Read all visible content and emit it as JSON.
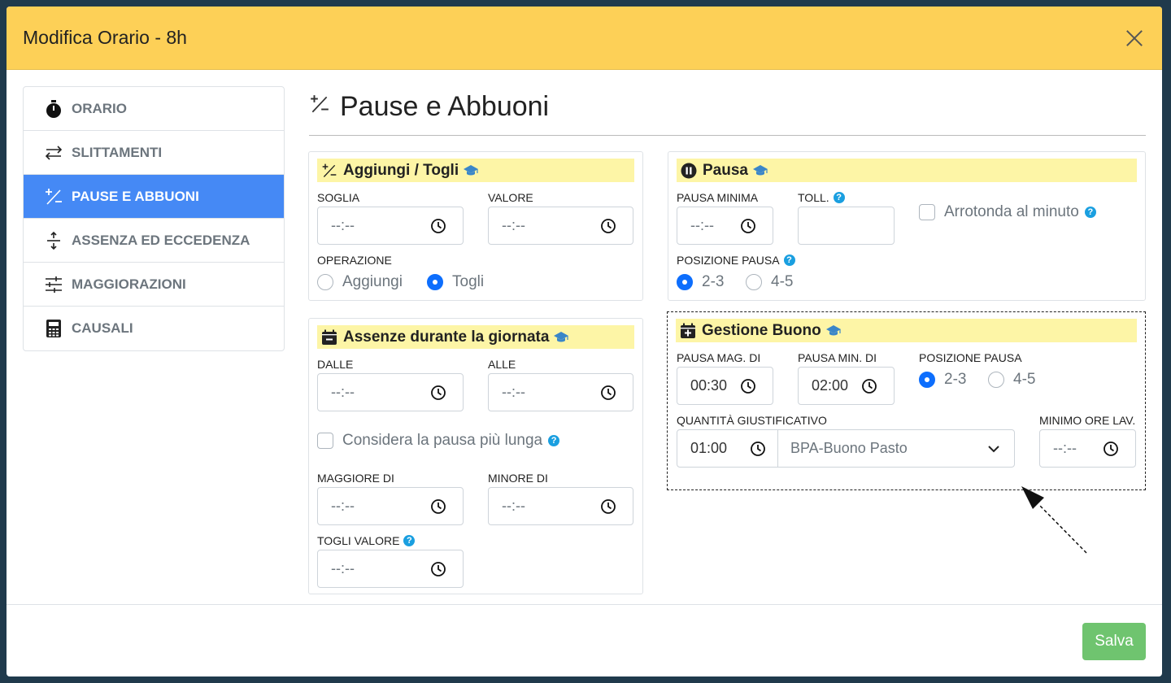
{
  "modal": {
    "title": "Modifica Orario - 8h",
    "save_label": "Salva"
  },
  "sidebar": {
    "items": [
      {
        "label": "ORARIO",
        "icon": "stopwatch-icon"
      },
      {
        "label": "SLITTAMENTI",
        "icon": "arrows-left-right-icon"
      },
      {
        "label": "PAUSE E ABBUONI",
        "icon": "plus-slash-minus-icon",
        "active": true
      },
      {
        "label": "ASSENZA ED ECCEDENZA",
        "icon": "arrows-vertical-expand-icon"
      },
      {
        "label": "MAGGIORAZIONI",
        "icon": "sliders-icon"
      },
      {
        "label": "CAUSALI",
        "icon": "calculator-icon"
      }
    ]
  },
  "page": {
    "title": "Pause e Abbuoni"
  },
  "aggiungi": {
    "title": "Aggiungi / Togli",
    "soglia_label": "SOGLIA",
    "soglia_value": "--:--",
    "valore_label": "VALORE",
    "valore_value": "--:--",
    "operazione_label": "OPERAZIONE",
    "opt_aggiungi": "Aggiungi",
    "opt_togli": "Togli",
    "selected": "Togli"
  },
  "pausa": {
    "title": "Pausa",
    "minima_label": "PAUSA MINIMA",
    "minima_value": "--:--",
    "toll_label": "TOLL.",
    "toll_value": "",
    "arrotonda_label": "Arrotonda al minuto",
    "posizione_label": "POSIZIONE PAUSA",
    "opt_a": "2-3",
    "opt_b": "4-5",
    "selected": "2-3"
  },
  "assenze": {
    "title": "Assenze durante la giornata",
    "dalle_label": "DALLE",
    "dalle_value": "--:--",
    "alle_label": "ALLE",
    "alle_value": "--:--",
    "considera_label": "Considera la pausa più lunga",
    "maggiore_label": "MAGGIORE DI",
    "maggiore_value": "--:--",
    "minore_label": "MINORE DI",
    "minore_value": "--:--",
    "togli_label": "TOGLI VALORE",
    "togli_value": "--:--"
  },
  "buono": {
    "title": "Gestione Buono",
    "mag_label": "PAUSA MAG. DI",
    "mag_value": "00:30",
    "min_label": "PAUSA MIN. DI",
    "min_value": "02:00",
    "posizione_label": "POSIZIONE PAUSA",
    "opt_a": "2-3",
    "opt_b": "4-5",
    "selected": "2-3",
    "quantita_label": "QUANTITÀ GIUSTIFICATIVO",
    "quantita_value": "01:00",
    "causale_value": "BPA-Buono Pasto",
    "minimo_label": "MINIMO ORE LAV.",
    "minimo_value": "--:--"
  }
}
